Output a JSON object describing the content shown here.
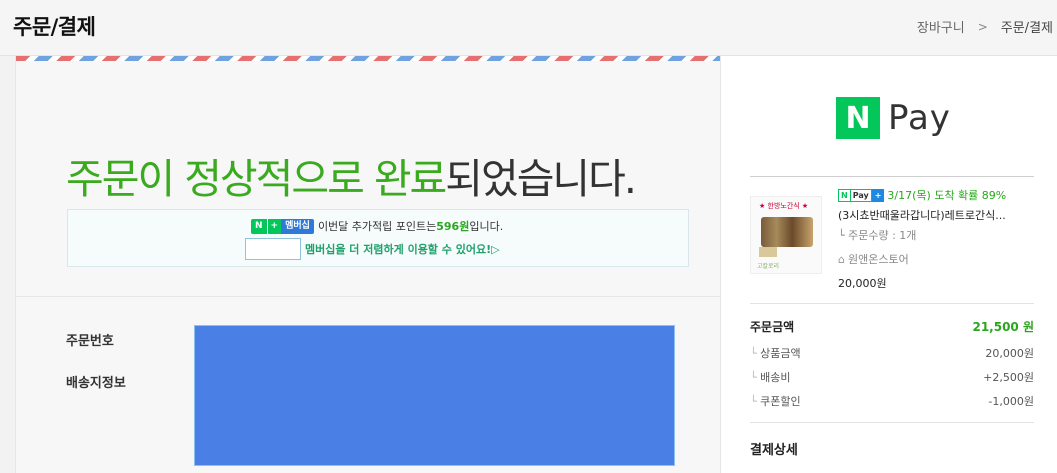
{
  "header": {
    "title": "주문/결제",
    "breadcrumb": [
      "장바구니",
      "주문/결제"
    ]
  },
  "main": {
    "headline_green": "주문이 정상적으로 완료",
    "headline_rest": "되었습니다.",
    "points": {
      "badge_n": "N",
      "badge_plus": "+",
      "badge_member": "멤버십",
      "text_before": "이번달 추가적립 포인트는 ",
      "amount": "596원",
      "text_after": "입니다.",
      "cta": "멤버십을 더 저렴하게 이용할 수 있어요!",
      "cta_icon": "▷"
    },
    "info": {
      "order_number_label": "주문번호",
      "shipping_label": "배송지정보"
    }
  },
  "sidebar": {
    "logo_n": "N",
    "logo_text": "Pay",
    "product": {
      "delivery": "3/17(목) 도착 확률 89%",
      "name": "(3시쵸반때울라갑니다)레트로간식...",
      "qty": "주문수량 : 1개",
      "store": "원앤온스토어",
      "price": "20,000원",
      "thumb_title": "★ 한방노간식 ★",
      "thumb_caption": "고칼로리"
    },
    "summary": {
      "order_total_label": "주문금액",
      "order_total": "21,500 원",
      "items_label": "상품금액",
      "items": "20,000원",
      "shipping_label": "배송비",
      "shipping": "+2,500원",
      "coupon_label": "쿠폰할인",
      "coupon": "-1,000원"
    },
    "payment_title": "결제상세"
  }
}
